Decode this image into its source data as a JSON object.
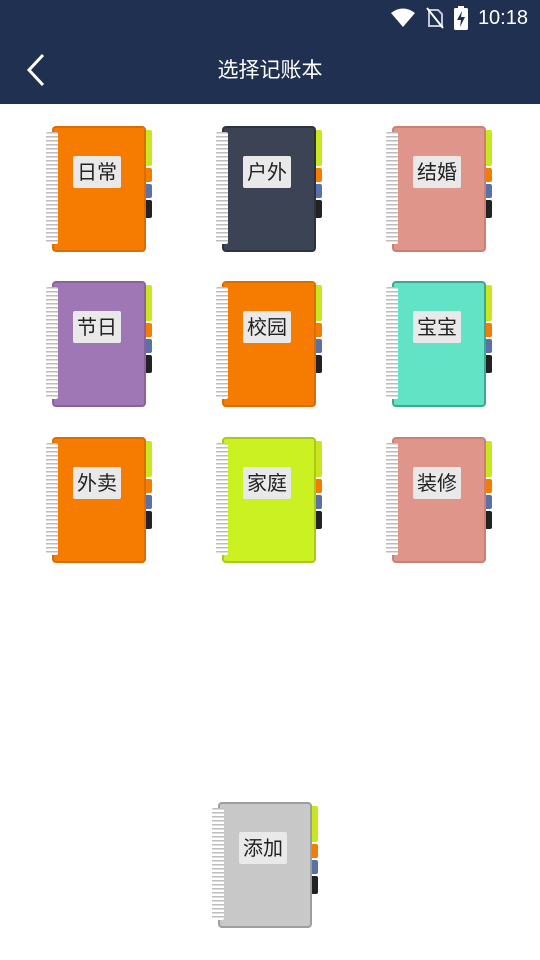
{
  "status": {
    "time": "10:18"
  },
  "nav": {
    "title": "选择记账本"
  },
  "books": [
    {
      "label": "日常",
      "color": "#f57c00",
      "edge": "#d96d00"
    },
    {
      "label": "户外",
      "color": "#3c4355",
      "edge": "#2c3240"
    },
    {
      "label": "结婚",
      "color": "#e0958b",
      "edge": "#c98077"
    },
    {
      "label": "节日",
      "color": "#a077b5",
      "edge": "#8a62a0"
    },
    {
      "label": "校园",
      "color": "#f57c00",
      "edge": "#d96d00"
    },
    {
      "label": "宝宝",
      "color": "#62e3c6",
      "edge": "#3aa98f"
    },
    {
      "label": "外卖",
      "color": "#f57c00",
      "edge": "#d96d00"
    },
    {
      "label": "家庭",
      "color": "#cbf123",
      "edge": "#a9c91a"
    },
    {
      "label": "装修",
      "color": "#e0958b",
      "edge": "#c98077"
    }
  ],
  "add": {
    "label": "添加",
    "color": "#c8c8c8",
    "edge": "#9e9e9e"
  },
  "tab_colors": [
    "#c9e61f",
    "#f57c00",
    "#5b6fa8",
    "#222222"
  ]
}
